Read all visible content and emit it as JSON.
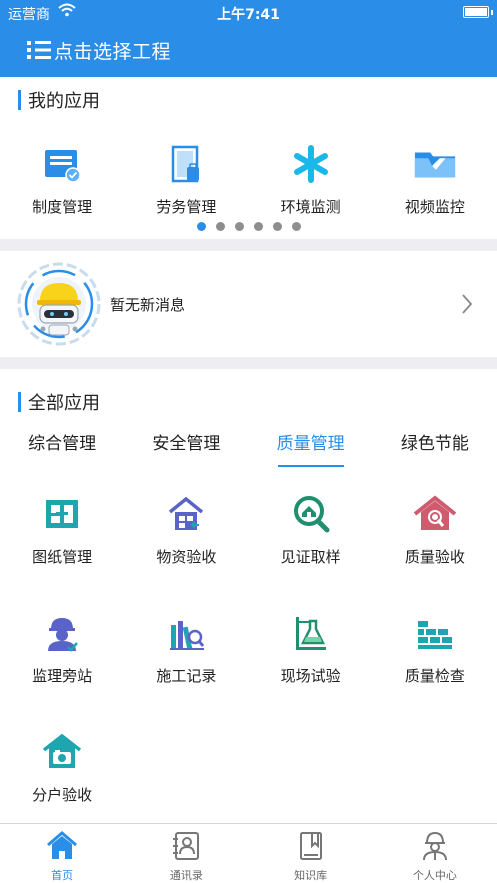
{
  "status_bar": {
    "carrier": "运营商",
    "time": "上午7:41"
  },
  "nav": {
    "title": "点击选择工程"
  },
  "my_apps": {
    "title": "我的应用",
    "items": [
      {
        "label": "制度管理",
        "icon": "document-list-icon"
      },
      {
        "label": "劳务管理",
        "icon": "door-badge-icon"
      },
      {
        "label": "环境监测",
        "icon": "asterisk-icon"
      },
      {
        "label": "视频监控",
        "icon": "video-folder-icon"
      }
    ],
    "page_count": 6,
    "active_page": 1
  },
  "message": {
    "text": "暂无新消息"
  },
  "all_apps": {
    "title": "全部应用",
    "tabs": [
      {
        "label": "综合管理"
      },
      {
        "label": "安全管理"
      },
      {
        "label": "质量管理",
        "active": true
      },
      {
        "label": "绿色节能"
      }
    ],
    "items": [
      {
        "label": "图纸管理",
        "icon": "blueprint-icon"
      },
      {
        "label": "物资验收",
        "icon": "warehouse-icon"
      },
      {
        "label": "见证取样",
        "icon": "search-house-icon"
      },
      {
        "label": "质量验收",
        "icon": "house-magnifier-icon"
      },
      {
        "label": "监理旁站",
        "icon": "worker-helmet-icon"
      },
      {
        "label": "施工记录",
        "icon": "books-search-icon"
      },
      {
        "label": "现场试验",
        "icon": "flask-icon"
      },
      {
        "label": "质量检查",
        "icon": "bricks-icon"
      },
      {
        "label": "分户验收",
        "icon": "house-camera-icon"
      }
    ]
  },
  "tabbar": {
    "items": [
      {
        "label": "首页",
        "icon": "home-icon",
        "active": true
      },
      {
        "label": "通讯录",
        "icon": "contacts-icon"
      },
      {
        "label": "知识库",
        "icon": "book-icon"
      },
      {
        "label": "个人中心",
        "icon": "user-helmet-icon"
      }
    ]
  },
  "colors": {
    "primary": "#2a8ee8",
    "inactive_dot": "#8e8e8e",
    "accent_teal": "#1fa5b0",
    "accent_pink": "#d05a6e",
    "accent_indigo": "#5a63c8"
  }
}
